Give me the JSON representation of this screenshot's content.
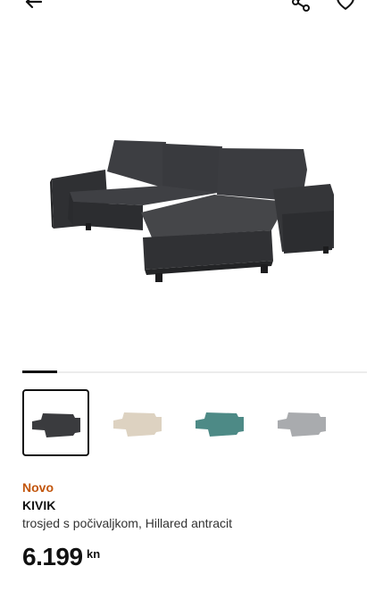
{
  "header": {
    "back_icon": "arrow-left-icon",
    "share_icon": "share-icon",
    "favourite_icon": "heart-icon"
  },
  "gallery": {
    "image_count": 4,
    "current_index": 1,
    "thumbnails": [
      {
        "color": "#3a3b3e",
        "label": "Hillared antracit"
      },
      {
        "color": "#ddd2c1",
        "label": "beige"
      },
      {
        "color": "#4d8a86",
        "label": "turquoise"
      },
      {
        "color": "#a9abae",
        "label": "grey"
      }
    ]
  },
  "product": {
    "badge": "Novo",
    "name": "KIVIK",
    "description": "trosjed s počivaljkom, Hillared antracit",
    "price": "6.199",
    "currency": "kn"
  },
  "colors": {
    "badge": "#c2560d",
    "text": "#111111"
  }
}
